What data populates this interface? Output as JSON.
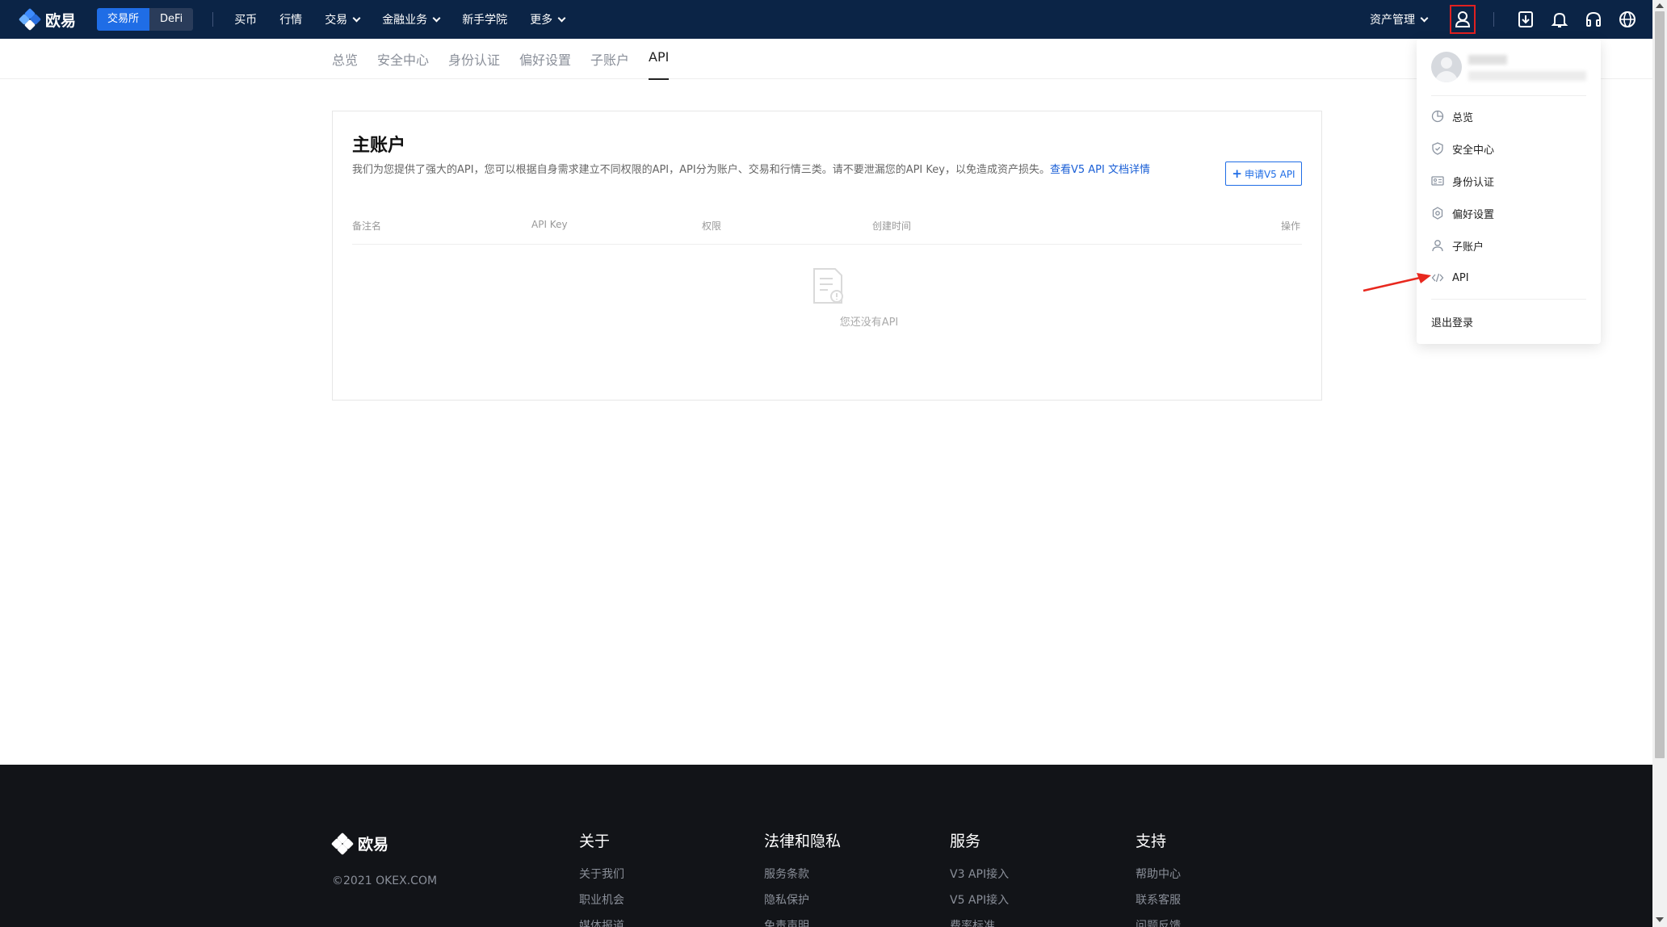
{
  "brand": {
    "name": "欧易"
  },
  "topnav": {
    "switch": {
      "exchange": "交易所",
      "defi": "DeFi"
    },
    "items": [
      {
        "label": "买币",
        "has_dropdown": false
      },
      {
        "label": "行情",
        "has_dropdown": false
      },
      {
        "label": "交易",
        "has_dropdown": true
      },
      {
        "label": "金融业务",
        "has_dropdown": true
      },
      {
        "label": "新手学院",
        "has_dropdown": false
      },
      {
        "label": "更多",
        "has_dropdown": true
      }
    ],
    "asset_management": "资产管理",
    "icons": [
      "user-icon",
      "download-icon",
      "bell-icon",
      "headset-icon",
      "globe-icon"
    ]
  },
  "subtabs": [
    {
      "label": "总览",
      "active": false
    },
    {
      "label": "安全中心",
      "active": false
    },
    {
      "label": "身份认证",
      "active": false
    },
    {
      "label": "偏好设置",
      "active": false
    },
    {
      "label": "子账户",
      "active": false
    },
    {
      "label": "API",
      "active": true
    }
  ],
  "card": {
    "title": "主账户",
    "description": "我们为您提供了强大的API，您可以根据自身需求建立不同权限的API，API分为账户、交易和行情三类。请不要泄漏您的API Key，以免造成资产损失。",
    "doc_link": "查看V5 API 文档详情",
    "apply_button": "申请V5 API",
    "columns": [
      "备注名",
      "API Key",
      "权限",
      "创建时间",
      "操作"
    ],
    "empty_text": "您还没有API"
  },
  "dropdown": {
    "items": [
      {
        "label": "总览",
        "icon": "pie-chart-icon"
      },
      {
        "label": "安全中心",
        "icon": "shield-icon"
      },
      {
        "label": "身份认证",
        "icon": "id-card-icon"
      },
      {
        "label": "偏好设置",
        "icon": "gear-icon"
      },
      {
        "label": "子账户",
        "icon": "user-icon"
      },
      {
        "label": "API",
        "icon": "code-icon"
      }
    ],
    "logout": "退出登录"
  },
  "footer": {
    "copyright": "©2021 OKEX.COM",
    "columns": [
      {
        "title": "关于",
        "links": [
          "关于我们",
          "职业机会",
          "媒体报道"
        ]
      },
      {
        "title": "法律和隐私",
        "links": [
          "服务条款",
          "隐私保护",
          "免责声明"
        ]
      },
      {
        "title": "服务",
        "links": [
          "V3 API接入",
          "V5 API接入",
          "费率标准"
        ]
      },
      {
        "title": "支持",
        "links": [
          "帮助中心",
          "联系客服",
          "问题反馈"
        ]
      }
    ]
  },
  "colors": {
    "nav_bg": "#0b2446",
    "accent": "#1f6de6",
    "footer_bg": "#121418",
    "highlight": "#e02020"
  }
}
